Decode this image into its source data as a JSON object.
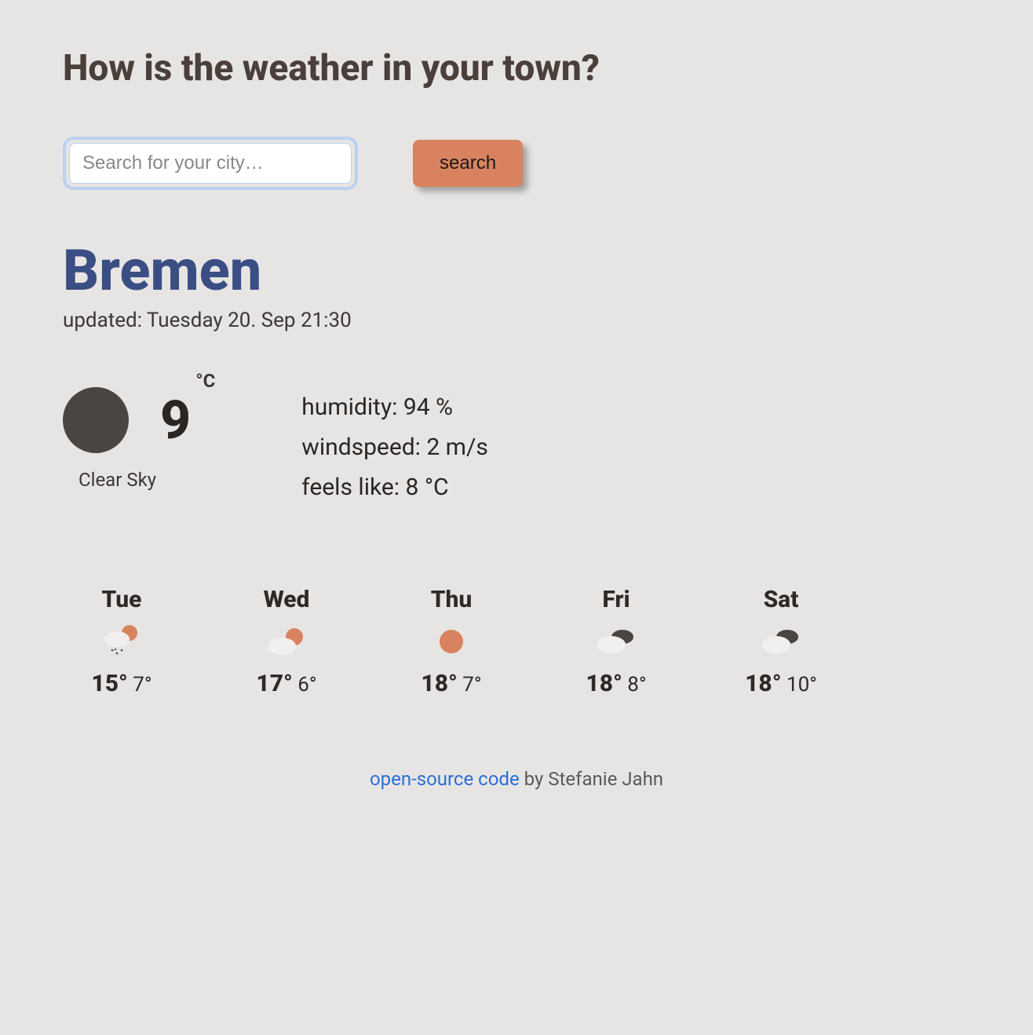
{
  "title": "How is the weather in your town?",
  "search": {
    "placeholder": "Search for your city…",
    "button_label": "search"
  },
  "city": "Bremen",
  "updated": "updated: Tuesday 20. Sep 21:30",
  "current": {
    "icon": "moon",
    "temp": "9",
    "unit": "°C",
    "condition": "Clear Sky",
    "humidity_label": "humidity: 94 %",
    "windspeed_label": "windspeed: 2 m/s",
    "feelslike_label": "feels like: 8 °C"
  },
  "forecast": [
    {
      "day": "Tue",
      "icon": "rain-sun",
      "hi": "15°",
      "lo": "7°"
    },
    {
      "day": "Wed",
      "icon": "cloud-sun",
      "hi": "17°",
      "lo": "6°"
    },
    {
      "day": "Thu",
      "icon": "sun",
      "hi": "18°",
      "lo": "7°"
    },
    {
      "day": "Fri",
      "icon": "cloudy",
      "hi": "18°",
      "lo": "8°"
    },
    {
      "day": "Sat",
      "icon": "cloudy",
      "hi": "18°",
      "lo": "10°"
    }
  ],
  "footer": {
    "link_text": "open-source code",
    "by_text": " by Stefanie Jahn"
  }
}
